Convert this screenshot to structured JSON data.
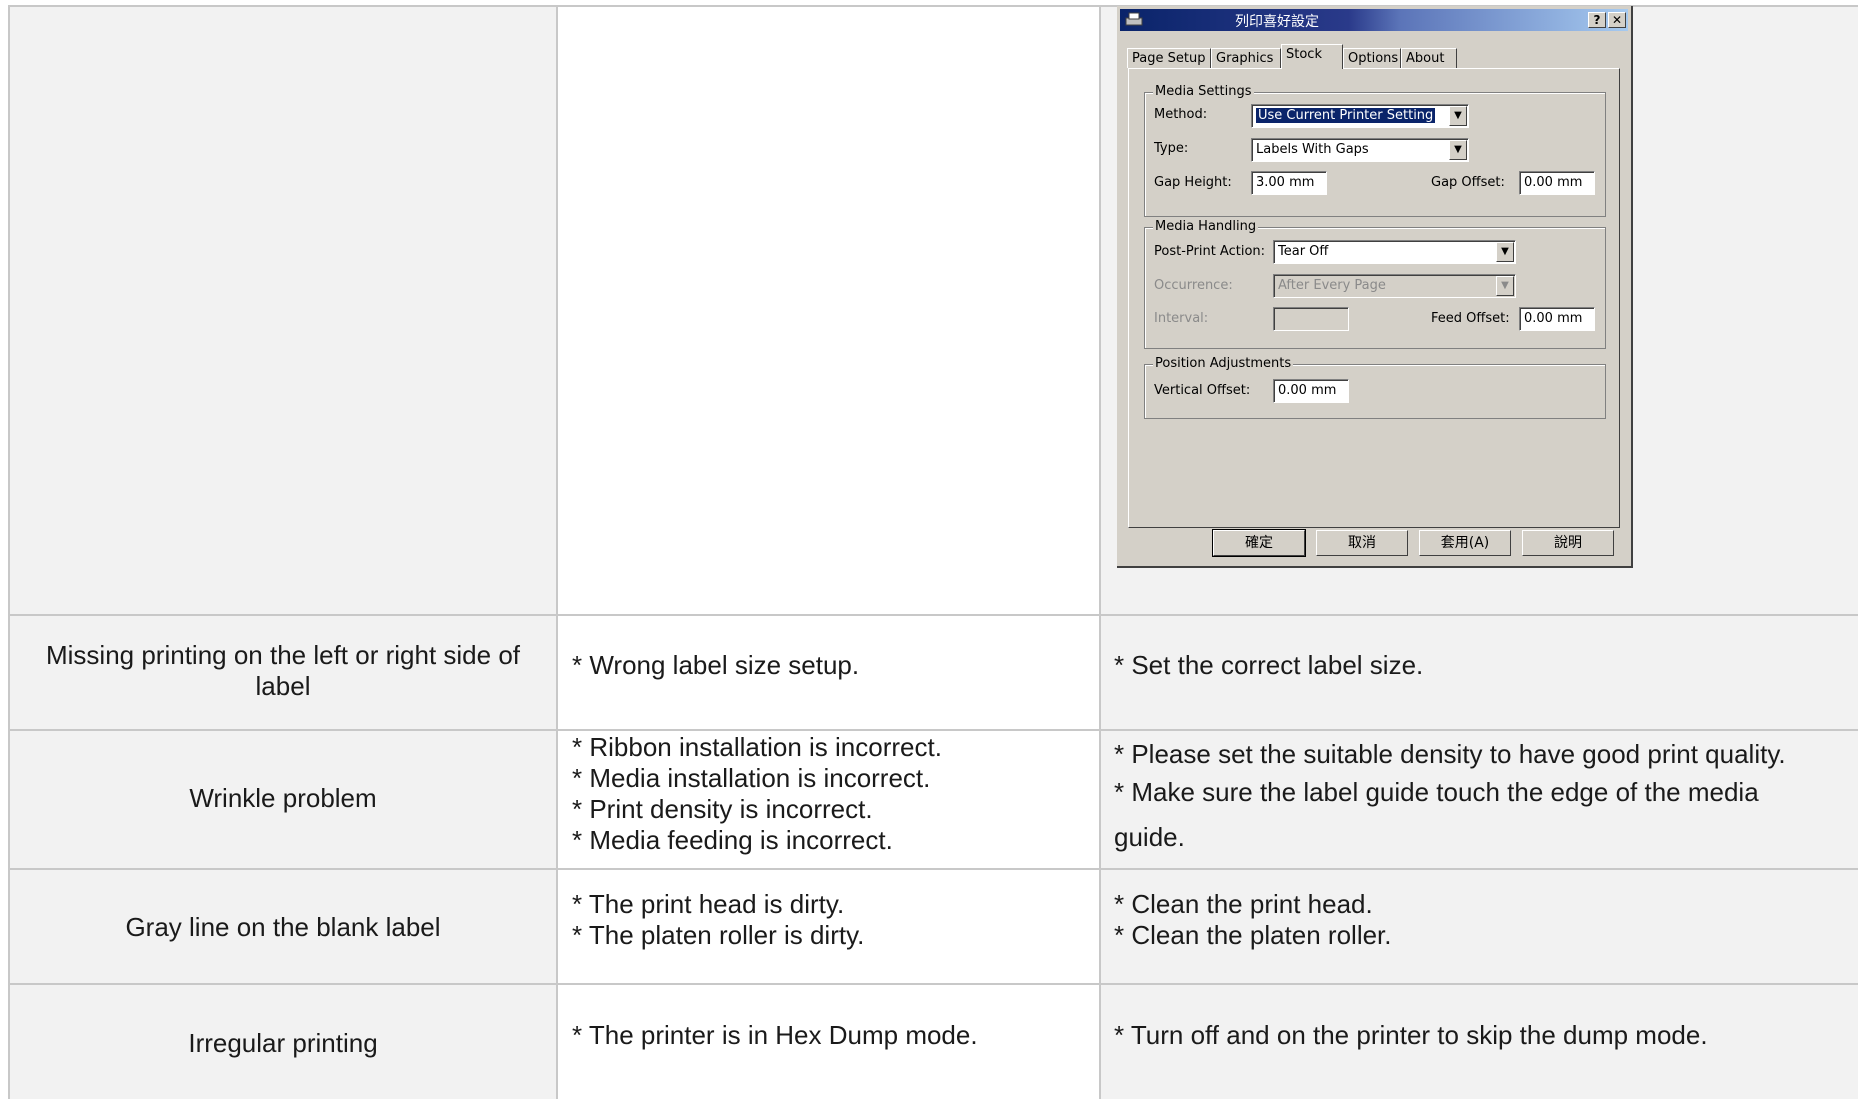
{
  "dialog": {
    "title": "列印喜好設定",
    "help_btn": "?",
    "close_btn": "✕",
    "tabs": [
      "Page Setup",
      "Graphics",
      "Stock",
      "Options",
      "About"
    ],
    "media_settings": {
      "legend": "Media Settings",
      "method_label": "Method:",
      "method_value": "Use Current Printer Setting",
      "type_label": "Type:",
      "type_value": "Labels With Gaps",
      "gap_height_label": "Gap Height:",
      "gap_height_value": "3.00 mm",
      "gap_offset_label": "Gap Offset:",
      "gap_offset_value": "0.00 mm"
    },
    "media_handling": {
      "legend": "Media Handling",
      "post_print_label": "Post-Print Action:",
      "post_print_value": "Tear Off",
      "occurrence_label": "Occurrence:",
      "occurrence_value": "After Every Page",
      "interval_label": "Interval:",
      "interval_value": "",
      "feed_offset_label": "Feed Offset:",
      "feed_offset_value": "0.00 mm"
    },
    "position": {
      "legend": "Position Adjustments",
      "vertical_offset_label": "Vertical Offset:",
      "vertical_offset_value": "0.00 mm"
    },
    "buttons": [
      "確定",
      "取消",
      "套用(A)",
      "說明"
    ]
  },
  "rows": [
    {
      "symptom": [
        "Missing printing on the left or right side of",
        "label"
      ],
      "causes": [
        "* Wrong label size setup."
      ],
      "solutions": [
        "* Set the correct label size."
      ]
    },
    {
      "symptom": [
        "Wrinkle problem"
      ],
      "causes": [
        "* Ribbon installation is incorrect.",
        "* Media installation is incorrect.",
        "* Print density is incorrect.",
        "* Media feeding is incorrect."
      ],
      "solutions": [
        "* Please set the suitable density to have good print quality.",
        "* Make sure the label guide touch the edge of the media",
        "guide."
      ]
    },
    {
      "symptom": [
        "Gray line on the blank label"
      ],
      "causes": [
        "* The print head is dirty.",
        "* The platen roller is dirty."
      ],
      "solutions": [
        "* Clean the print head.",
        "* Clean the platen roller."
      ]
    },
    {
      "symptom": [
        "Irregular printing"
      ],
      "causes": [
        "* The printer is in Hex Dump mode."
      ],
      "solutions": [
        "* Turn off and on the printer to skip the dump mode."
      ]
    }
  ]
}
